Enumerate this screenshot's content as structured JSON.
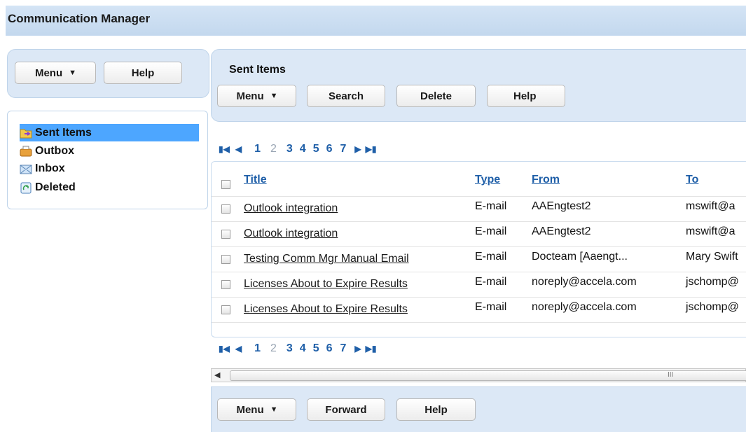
{
  "app": {
    "title": "Communication Manager"
  },
  "left_toolbar": {
    "menu_label": "Menu",
    "help_label": "Help"
  },
  "folders": [
    {
      "label": "Sent Items",
      "icon": "sent-items-folder-icon",
      "selected": true
    },
    {
      "label": "Outbox",
      "icon": "outbox-icon",
      "selected": false
    },
    {
      "label": "Inbox",
      "icon": "inbox-icon",
      "selected": false
    },
    {
      "label": "Deleted",
      "icon": "recycle-bin-icon",
      "selected": false
    }
  ],
  "main": {
    "heading": "Sent Items",
    "toolbar": {
      "menu_label": "Menu",
      "search_label": "Search",
      "delete_label": "Delete",
      "help_label": "Help"
    }
  },
  "pager": {
    "pages": [
      "1",
      "2",
      "3",
      "4",
      "5",
      "6",
      "7"
    ],
    "current": "2"
  },
  "table": {
    "columns": [
      "Title",
      "Type",
      "From",
      "To"
    ],
    "rows": [
      {
        "title": "Outlook integration",
        "type": "E-mail",
        "from": "AAEngtest2",
        "to": "mswift@a"
      },
      {
        "title": "Outlook integration",
        "type": "E-mail",
        "from": "AAEngtest2",
        "to": "mswift@a"
      },
      {
        "title": "Testing Comm Mgr Manual Email",
        "type": "E-mail",
        "from": "Docteam [Aaengt...",
        "to": "Mary Swift"
      },
      {
        "title": "Licenses About to Expire Results",
        "type": "E-mail",
        "from": "noreply@accela.com",
        "to": "jschomp@"
      },
      {
        "title": "Licenses About to Expire Results",
        "type": "E-mail",
        "from": "noreply@accela.com",
        "to": "jschomp@"
      }
    ]
  },
  "scrollbar": {
    "grip": "III"
  },
  "bottom_toolbar": {
    "menu_label": "Menu",
    "forward_label": "Forward",
    "help_label": "Help"
  },
  "colors": {
    "panel_bg": "#dce8f6",
    "link": "#1f5fa8",
    "selection": "#4da6ff"
  }
}
